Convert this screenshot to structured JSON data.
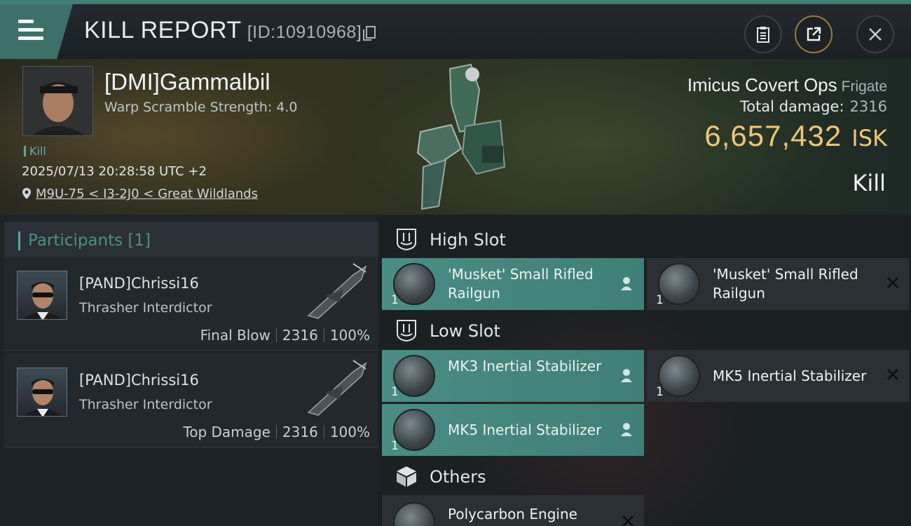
{
  "header": {
    "title": "KILL REPORT",
    "id_text": "[ID:10910968]"
  },
  "victim": {
    "name": "[DMI]Gammalbil",
    "warp_scramble": "Warp Scramble Strength: 4.0",
    "kill_tag": "Kill",
    "timestamp": "2025/07/13 20:28:58 UTC +2",
    "location": "M9U-75 < I3-2J0 < Great Wildlands",
    "ship_name": "Imicus Covert Ops",
    "ship_class": "Frigate",
    "total_damage_label": "Total damage:",
    "total_damage_value": "2316",
    "isk_value": "6,657,432",
    "isk_currency": "ISK",
    "result": "Kill"
  },
  "participants": {
    "heading": "Participants [1]",
    "rows": [
      {
        "name": "[PAND]Chrissi16",
        "ship": "Thrasher Interdictor",
        "role": "Final Blow",
        "damage": "2316",
        "percent": "100%"
      },
      {
        "name": "[PAND]Chrissi16",
        "ship": "Thrasher Interdictor",
        "role": "Top Damage",
        "damage": "2316",
        "percent": "100%"
      }
    ]
  },
  "fittings": {
    "high_slot": {
      "label": "High Slot",
      "items": [
        {
          "name": "'Musket' Small Rifled Railgun",
          "qty": "1",
          "state": "fitted"
        },
        {
          "name": "'Musket' Small Rifled Railgun",
          "qty": "1",
          "state": "destroyed"
        }
      ]
    },
    "low_slot": {
      "label": "Low Slot",
      "items": [
        {
          "name": "MK3 Inertial Stabilizer",
          "qty": "1",
          "state": "fitted"
        },
        {
          "name": "MK5 Inertial Stabilizer",
          "qty": "1",
          "state": "destroyed"
        },
        {
          "name": "MK5 Inertial Stabilizer",
          "qty": "1",
          "state": "fitted"
        }
      ]
    },
    "others": {
      "label": "Others",
      "items": [
        {
          "name": "Polycarbon Engine",
          "qty": "",
          "state": "destroyed"
        }
      ]
    }
  },
  "icons": {
    "menu": "hamburger-icon",
    "copy": "copy-icon",
    "clipboard": "clipboard-icon",
    "share": "share-icon",
    "close": "close-icon",
    "location": "location-pin-icon",
    "high_slot": "high-slot-icon",
    "low_slot": "low-slot-icon",
    "others": "cube-icon",
    "fitted_user": "person-icon",
    "destroyed": "x-icon"
  },
  "colors": {
    "accent_teal": "#3f7f77",
    "isk_gold": "#efc57a"
  }
}
